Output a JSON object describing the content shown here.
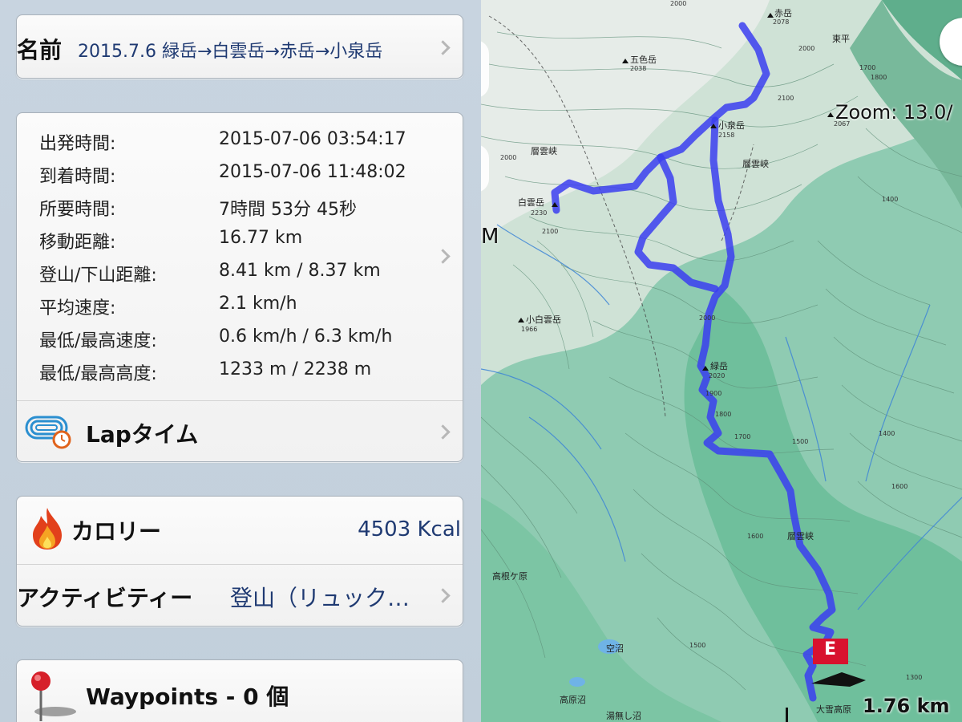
{
  "name_card": {
    "label": "名前",
    "value": "2015.7.6 緑岳→白雲岳→赤岳→小泉岳"
  },
  "stats": [
    {
      "label": "出発時間:",
      "value": "2015-07-06 03:54:17"
    },
    {
      "label": "到着時間:",
      "value": "2015-07-06 11:48:02"
    },
    {
      "label": "所要時間:",
      "value": "7時間 53分 45秒"
    },
    {
      "label": "移動距離:",
      "value": "16.77 km"
    },
    {
      "label": "登山/下山距離:",
      "value": "8.41 km / 8.37 km"
    },
    {
      "label": "平均速度:",
      "value": "2.1 km/h"
    },
    {
      "label": "最低/最高速度:",
      "value": "0.6 km/h / 6.3 km/h"
    },
    {
      "label": "最低/最高高度:",
      "value": "1233 m / 2238 m"
    }
  ],
  "lap": {
    "label": "Lapタイム"
  },
  "calorie": {
    "label": "カロリー",
    "value": "4503 Kcal"
  },
  "activity": {
    "label": "アクティビティー",
    "value": "登山（リュック…"
  },
  "waypoints": {
    "label": "Waypoints - 0 個"
  },
  "map": {
    "zoom": "Zoom: 13.0/",
    "scale": "1.76 km",
    "edge_letter": "M",
    "end_marker": "E",
    "route_color": "#3b3ef0",
    "peaks": [
      {
        "name": "赤岳",
        "elev": "2078"
      },
      {
        "name": "五色岳",
        "elev": "2038"
      },
      {
        "name": "小泉岳",
        "elev": "2158"
      },
      {
        "name": "",
        "elev": "2067"
      },
      {
        "name": "白雲岳",
        "elev": "2230"
      },
      {
        "name": "小白雲岳",
        "elev": "1966"
      },
      {
        "name": "緑岳",
        "elev": "2020"
      }
    ],
    "places": [
      {
        "name": "東平"
      },
      {
        "name": "層雲峡"
      },
      {
        "name": "層雲峡"
      },
      {
        "name": "層雲峡"
      },
      {
        "name": "高根ケ原"
      },
      {
        "name": "空沼"
      },
      {
        "name": "高原沼"
      },
      {
        "name": "湯無し沼"
      },
      {
        "name": "大雪高原"
      }
    ],
    "contours": [
      "2000",
      "2100",
      "2000",
      "2100",
      "2000",
      "1900",
      "1800",
      "1700",
      "1600",
      "1500",
      "1400",
      "1300",
      "1500",
      "1600",
      "1700",
      "1800",
      "1400",
      "2000"
    ]
  }
}
